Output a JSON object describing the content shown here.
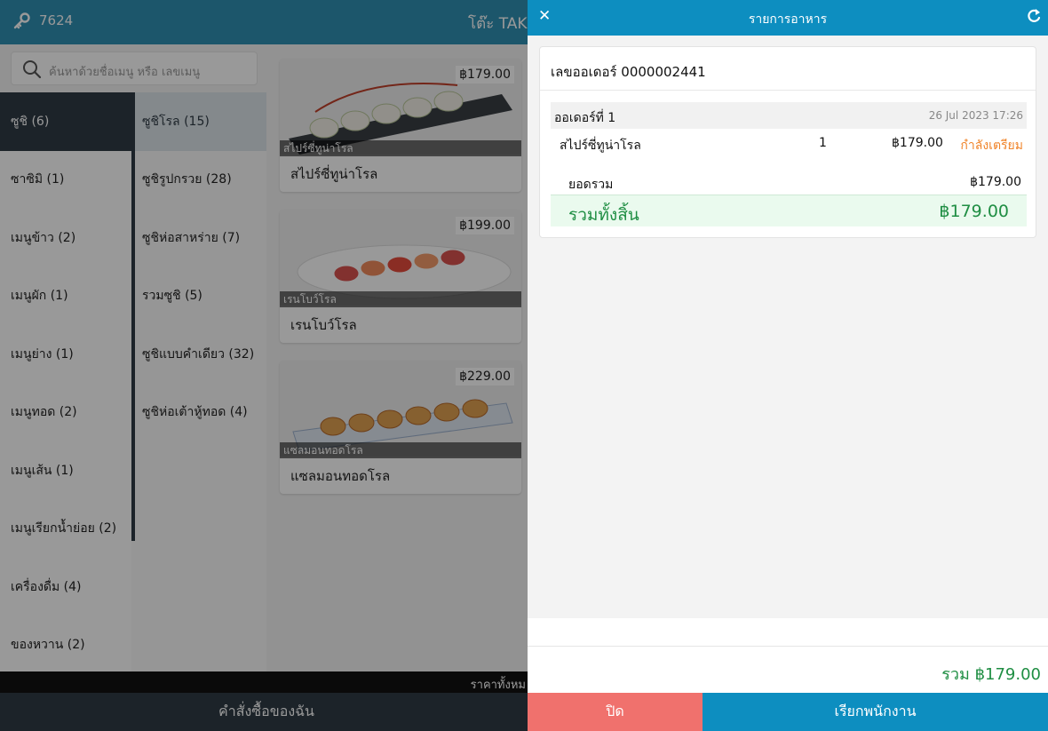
{
  "topbar": {
    "code": "7624",
    "table_label": "โต๊ะ TAKE"
  },
  "search": {
    "placeholder": "ค้นหาด้วยชื่อเมนู หรือ เลขเมนู"
  },
  "categories": [
    {
      "label": "ซูชิ (6)"
    },
    {
      "label": "ซาซิมิ (1)"
    },
    {
      "label": "เมนูข้าว (2)"
    },
    {
      "label": "เมนูผัก (1)"
    },
    {
      "label": "เมนูย่าง (1)"
    },
    {
      "label": "เมนูทอด (2)"
    },
    {
      "label": "เมนูเส้น (1)"
    },
    {
      "label": "เมนูเรียกน้ำย่อย (2)"
    },
    {
      "label": "เครื่องดื่ม (4)"
    },
    {
      "label": "ของหวาน (2)"
    }
  ],
  "subcategories": [
    {
      "label": "ซูชิโรล (15)"
    },
    {
      "label": "ซูชิรูปกรวย (28)"
    },
    {
      "label": "ซูชิห่อสาหร่าย (7)"
    },
    {
      "label": "รวมซูชิ (5)"
    },
    {
      "label": "ซูชิแบบคำเดียว (32)"
    },
    {
      "label": "ซูชิห่อเต้าหู้ทอด (4)"
    }
  ],
  "products": [
    {
      "name": "สไปร์ซี่ทูน่าโรล",
      "price": "฿179.00"
    },
    {
      "name": "เรนโบว์โรล",
      "price": "฿199.00"
    },
    {
      "name": "แซลมอนทอดโรล",
      "price": "฿229.00"
    }
  ],
  "left_footer": {
    "total_label": "ราคาทั้งหม",
    "orders_button": "คำสั่งซื้อของฉัน"
  },
  "panel": {
    "title": "รายการอาหาร",
    "order_number": "เลขออเดอร์ 0000002441",
    "order_label": "ออเดอร์ที่ 1",
    "order_date": "26 Jul 2023 17:26",
    "item": {
      "name": "สไปร์ซี่ทูน่าโรล",
      "qty": "1",
      "price": "฿179.00",
      "status": "กำลังเตรียม"
    },
    "subtotal_label": "ยอดรวม",
    "subtotal_value": "฿179.00",
    "grand_label": "รวมทั้งสิ้น",
    "grand_value": "฿179.00",
    "footer_sum": "รวม ฿179.00",
    "close_button": "ปิด",
    "call_button": "เรียกพนักงาน"
  },
  "colors": {
    "header": "#0d8ec0",
    "accent_green": "#1f8e43",
    "status_orange": "#f0842a",
    "close_red": "#f0716d",
    "dark_nav": "#2f3b45"
  }
}
